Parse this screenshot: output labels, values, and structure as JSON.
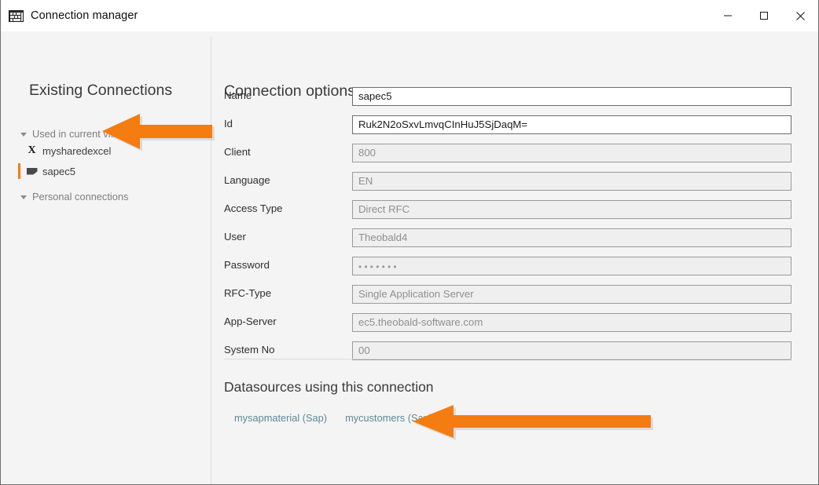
{
  "window": {
    "title": "Connection manager",
    "icon": "app-table-icon",
    "controls": {
      "minimize": "minimize-icon",
      "maximize": "maximize-icon",
      "close": "close-icon"
    }
  },
  "sidebar": {
    "title": "Existing Connections",
    "groups": [
      {
        "label": "Used in current visualization",
        "expanded": true
      },
      {
        "label": "Personal connections",
        "expanded": true
      }
    ],
    "items": [
      {
        "label": "mysharedexcel",
        "icon": "excel-icon",
        "selected": false
      },
      {
        "label": "sapec5",
        "icon": "sap-flag-icon",
        "selected": true
      }
    ]
  },
  "main": {
    "title": "Connection options",
    "fields": [
      {
        "label": "Name",
        "value": "sapec5",
        "editable": true,
        "password": false
      },
      {
        "label": "Id",
        "value": "Ruk2N2oSxvLmvqCInHuJ5SjDaqM=",
        "editable": true,
        "password": false
      },
      {
        "label": "Client",
        "value": "800",
        "editable": false,
        "password": false
      },
      {
        "label": "Language",
        "value": "EN",
        "editable": false,
        "password": false
      },
      {
        "label": "Access Type",
        "value": "Direct RFC",
        "editable": false,
        "password": false
      },
      {
        "label": "User",
        "value": "Theobald4",
        "editable": false,
        "password": false
      },
      {
        "label": "Password",
        "value": "•••••••",
        "editable": false,
        "password": true
      },
      {
        "label": "RFC-Type",
        "value": "Single Application Server",
        "editable": false,
        "password": false
      },
      {
        "label": "App-Server",
        "value": "ec5.theobald-software.com",
        "editable": false,
        "password": false
      },
      {
        "label": "System No",
        "value": "00",
        "editable": false,
        "password": false
      }
    ],
    "datasources": {
      "title": "Datasources using this connection",
      "links": [
        {
          "label": "mysapmaterial (Sap)"
        },
        {
          "label": "mycustomers (Sap)"
        }
      ]
    }
  },
  "annotations": {
    "arrows": [
      {
        "name": "arrow-pointing-to-sapec5",
        "direction": "left"
      },
      {
        "name": "arrow-pointing-to-datasources",
        "direction": "left"
      }
    ]
  },
  "colors": {
    "accent_orange": "#f57c10",
    "link_teal": "#5c8a97",
    "panel_bg": "#f4f4f4",
    "title_text": "#3b3b3b"
  }
}
